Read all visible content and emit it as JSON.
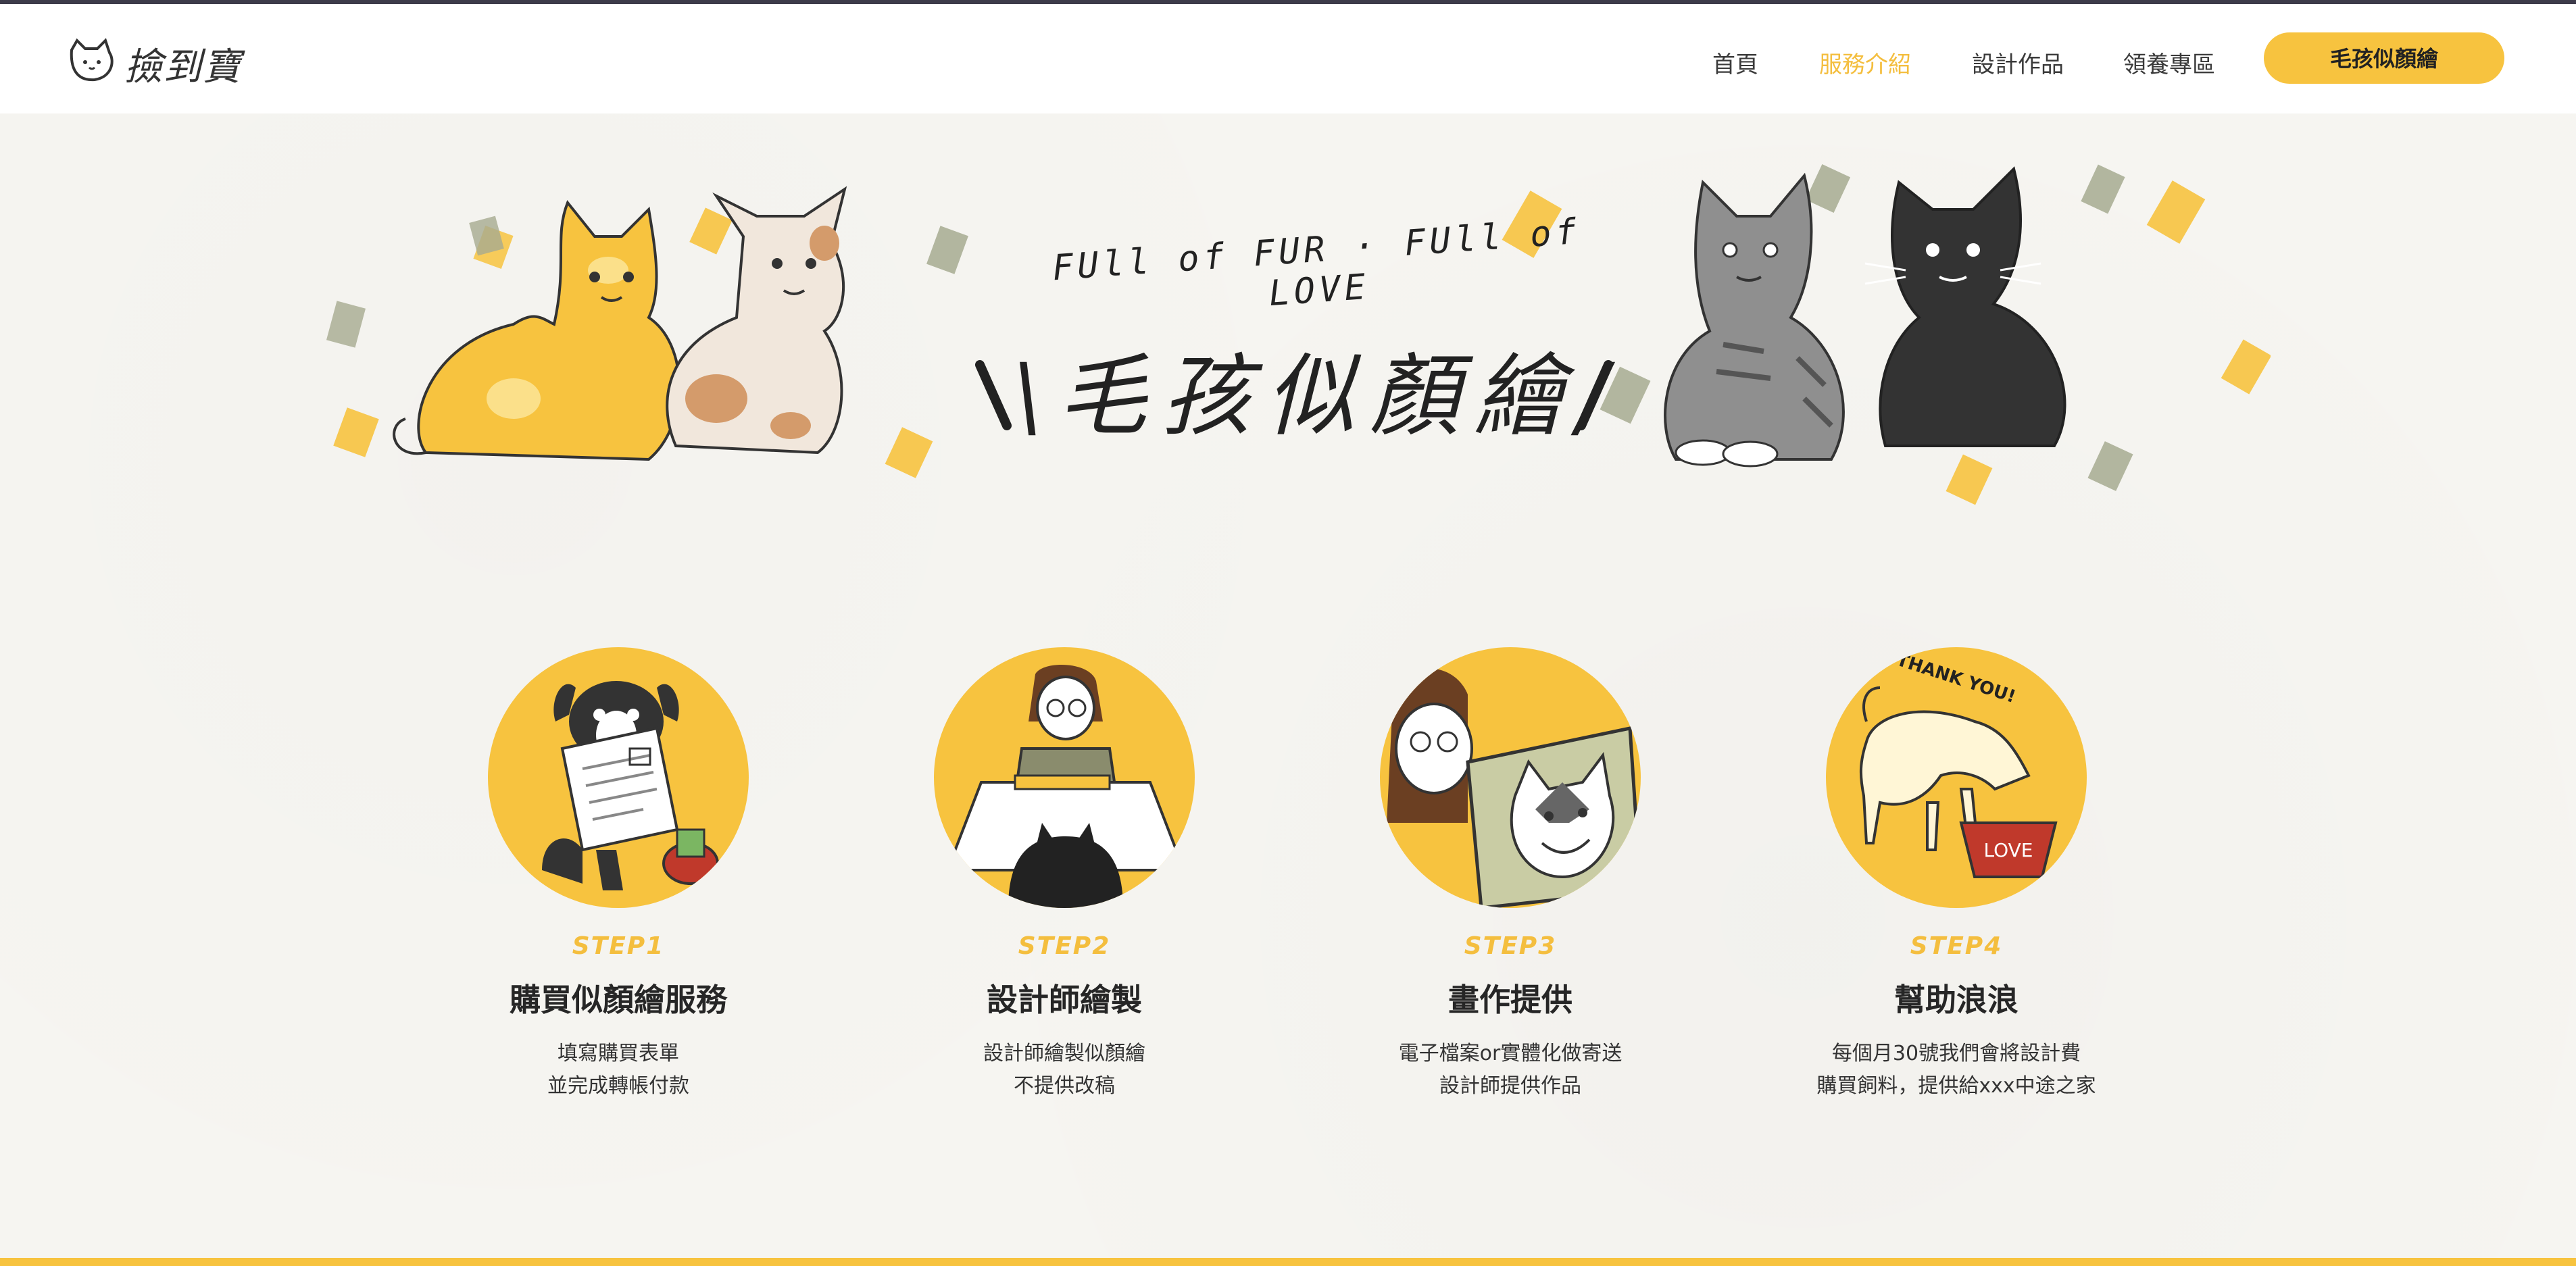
{
  "header": {
    "logo_text": "撿到寶",
    "nav": [
      {
        "label": "首頁",
        "active": false
      },
      {
        "label": "服務介紹",
        "active": true
      },
      {
        "label": "設計作品",
        "active": false
      },
      {
        "label": "領養專區",
        "active": false
      }
    ],
    "cta_label": "毛孩似顏繪"
  },
  "hero": {
    "tagline": "FUll of FUR · FUll of LOVE",
    "title": "\\毛孩似顏繪/"
  },
  "steps": [
    {
      "label": "STEP1",
      "title": "購買似顏繪服務",
      "desc": [
        "填寫購買表單",
        "並完成轉帳付款"
      ]
    },
    {
      "label": "STEP2",
      "title": "設計師繪製",
      "desc": [
        "設計師繪製似顏繪",
        "不提供改稿"
      ]
    },
    {
      "label": "STEP3",
      "title": "畫作提供",
      "desc": [
        "電子檔案or實體化做寄送",
        "設計師提供作品"
      ]
    },
    {
      "label": "STEP4",
      "title": "幫助浪浪",
      "desc": [
        "每個月30號我們會將設計費",
        "購買飼料，提供給xxx中途之家"
      ]
    }
  ],
  "step4_art": {
    "bowl_text": "LOVE",
    "thanks_text": "THANK YOU!"
  },
  "colors": {
    "accent": "#f7c33f",
    "active_nav": "#f4be3e",
    "background": "#f6f5f1"
  }
}
